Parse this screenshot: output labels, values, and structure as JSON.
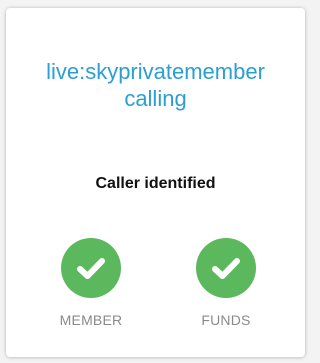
{
  "caller": {
    "line1": "live:skyprivatemember",
    "line2": "calling"
  },
  "status_text": "Caller identified",
  "checks": [
    {
      "label": "MEMBER",
      "icon": "check-icon",
      "status": "passed"
    },
    {
      "label": "FUNDS",
      "icon": "check-icon",
      "status": "passed"
    }
  ],
  "colors": {
    "accent": "#2b9fd1",
    "success": "#5cb85c",
    "muted": "#8a8a8a"
  }
}
